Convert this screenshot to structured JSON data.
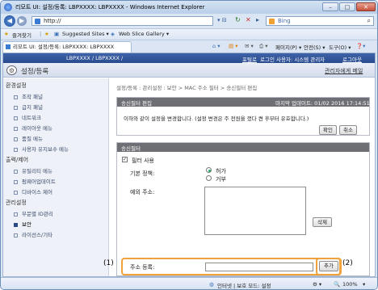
{
  "window": {
    "title": "리모트 UI: 설정/등록: LBPXXXX: LBPXXXX - Windows Internet Explorer",
    "min": "–",
    "max": "□",
    "close": "✕"
  },
  "browser": {
    "address": "http://",
    "search_placeholder": "Bing",
    "favorites": {
      "label": "즐겨찾기",
      "suggested": "Suggested Sites ▾",
      "gallery": "Web Slice Gallery ▾"
    },
    "tab": "리모트 UI: 설정/등록: LBPXXXX: LBPXXXX",
    "commands": {
      "page": "페이지(P) ▾",
      "safety": "안전(S) ▾",
      "tools": "도구(O) ▾",
      "help": "❓▾"
    }
  },
  "page_header": {
    "printer": "LBPXXXX / LBPXXXX /",
    "portal": "포털로",
    "login": "로그인 사용자: 시스템 관리자",
    "logout": "로그아웃"
  },
  "sub_header": {
    "title": "설정/등록",
    "admin_link": "관리자에게 메일"
  },
  "sidebar": {
    "sections": [
      {
        "title": "환경설정",
        "items": [
          "조작 패널",
          "급지 패널",
          "네트워크",
          "레이아웃 메뉴",
          "품질 메뉴",
          "사용자 유지보수 메뉴"
        ]
      },
      {
        "title": "출력/제어",
        "items": [
          "유틸리티 메뉴",
          "펌웨어업데이트",
          "디바이스 제어"
        ]
      },
      {
        "title": "관리설정",
        "items": [
          "부문별 ID관리",
          "보안",
          "라이선스/기타"
        ]
      }
    ],
    "selected": "보안"
  },
  "breadcrumb": "설정/등록 : 관리설정 : 보안 > MAC 주소 필터 > 송신필터 편집",
  "edit_panel": {
    "title": "송신필터 편집",
    "updated": "마지막 업데이트: 01/02 2016 17:14:51",
    "message": "이하와 같이 설정을 변경합니다. (설정 변경은 주 전원을 껐다 켠 후부터 유효합니다.)",
    "ok": "확인",
    "cancel": "취소"
  },
  "filter_panel": {
    "title": "송신필터",
    "use_filter_label": "필터 사용",
    "use_filter_checked": true,
    "policy_label": "기본 정책:",
    "policy_options": [
      "허가",
      "거부"
    ],
    "policy_selected": "허가",
    "exception_label": "예외 주소:",
    "delete": "삭제",
    "register_label": "주소 등록:",
    "register_value": "",
    "add": "추가"
  },
  "callouts": {
    "one": "(1)",
    "two": "(2)"
  },
  "statusbar": {
    "zone": "인터넷 | 보호 모드: 설정",
    "zoom": "100%"
  }
}
